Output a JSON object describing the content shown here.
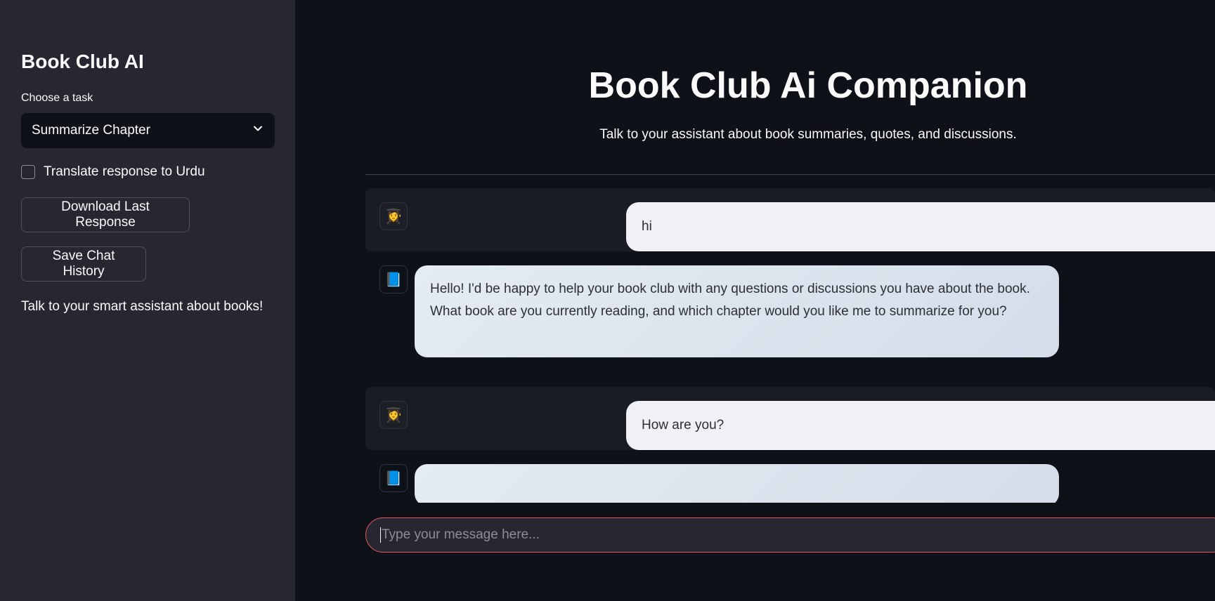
{
  "sidebar": {
    "title": "Book Club AI",
    "task_label": "Choose a task",
    "task_selected": "Summarize Chapter",
    "translate_label": "Translate response to Urdu",
    "translate_checked": false,
    "download_button": "Download Last Response",
    "save_button": "Save Chat History",
    "tagline": "Talk to your smart assistant about books!"
  },
  "main": {
    "title": "Book Club Ai Companion",
    "subtitle": "Talk to your assistant about book summaries, quotes, and discussions."
  },
  "chat": {
    "messages": [
      {
        "role": "user",
        "avatar": "👩‍🎓",
        "text": "hi"
      },
      {
        "role": "assistant",
        "avatar": "📘",
        "text": "Hello! I'd be happy to help your book club with any questions or discussions you have about the book. What book are you currently reading, and which chapter would you like me to summarize for you?"
      },
      {
        "role": "user",
        "avatar": "👩‍🎓",
        "text": "How are you?"
      },
      {
        "role": "assistant",
        "avatar": "📘",
        "text": ""
      }
    ]
  },
  "input": {
    "placeholder": "Type your message here..."
  },
  "colors": {
    "app_bg": "#0e1117",
    "sidebar_bg": "#262730",
    "user_bubble": "#f0f1f6",
    "assistant_bubble": "#dbe3ee",
    "input_border": "#e2585b"
  },
  "icons": {
    "user_avatar": "student-avatar-icon",
    "assistant_avatar": "blue-book-icon",
    "select_chevron": "chevron-down-icon"
  }
}
